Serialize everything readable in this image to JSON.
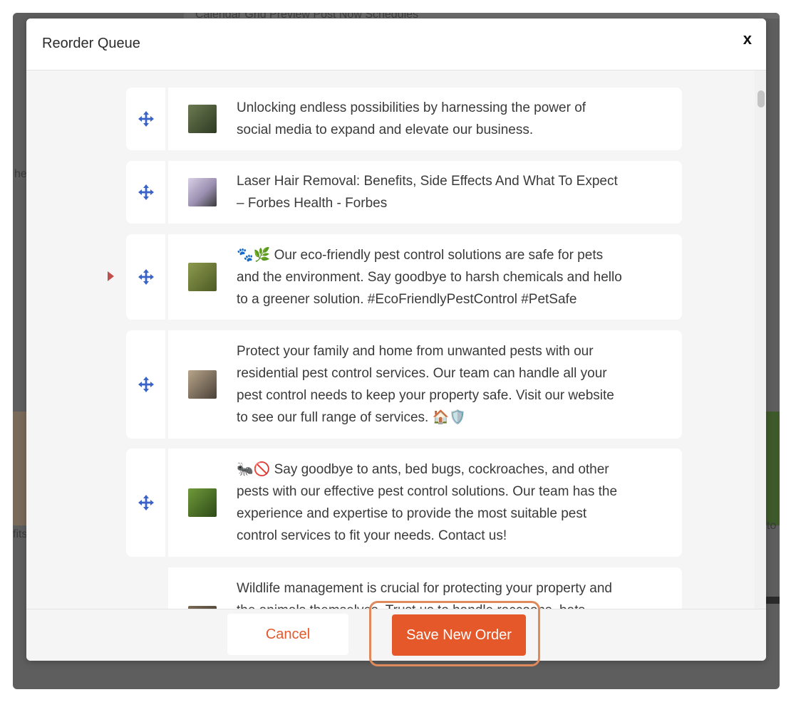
{
  "modal": {
    "title": "Reorder Queue",
    "close_label": "x"
  },
  "background": {
    "tabs": "Calendar   Grid Preview   Post Now   Schedules",
    "left_fragments": [
      "he",
      "fits"
    ],
    "right_fragment": "to"
  },
  "colors": {
    "accent": "#e4582a",
    "move_icon": "#3a63c8",
    "current_marker": "#c0504d",
    "focus_ring": "#e08a5c"
  },
  "queue": {
    "items": [
      {
        "text": "Unlocking endless possibilities by harnessing the power of\nsocial media to expand and elevate our business.",
        "thumb_icon": "person-with-camera-photo",
        "thumb_colors": [
          "#6b7a52",
          "#2f3a22"
        ],
        "current": false
      },
      {
        "text": "Laser Hair Removal: Benefits, Side Effects And What To Expect\n– Forbes Health - Forbes",
        "thumb_icon": "woman-face-photo",
        "thumb_colors": [
          "#d9d0e6",
          "#3a3a3a"
        ],
        "current": false
      },
      {
        "text": "🐾🌿 Our eco-friendly pest control solutions are safe for pets\nand the environment. Say goodbye to harsh chemicals and hello\nto a greener solution. #EcoFriendlyPestControl #PetSafe",
        "thumb_icon": "grass-field-photo",
        "thumb_colors": [
          "#8c9a4e",
          "#4d5a24"
        ],
        "current": true
      },
      {
        "text": "Protect your family and home from unwanted pests with our\nresidential pest control services. Our team can handle all your\npest control needs to keep your property safe. Visit our website\nto see our full range of services. 🏠🛡️",
        "thumb_icon": "technician-spraying-photo",
        "thumb_colors": [
          "#b8a58a",
          "#4a4038"
        ],
        "current": false
      },
      {
        "text": "🐜🚫 Say goodbye to ants, bed bugs, cockroaches, and other\npests with our effective pest control solutions. Our team has the\nexperience and expertise to provide the most suitable pest\ncontrol services to fit your needs. Contact us!",
        "thumb_icon": "insect-on-leaf-photo",
        "thumb_colors": [
          "#6f9a3a",
          "#2e4a18"
        ],
        "current": false
      },
      {
        "text": "Wildlife management is crucial for protecting your property and\nthe animals themselves. Trust us to handle raccoons, bats,",
        "thumb_icon": "wildlife-photo",
        "thumb_colors": [
          "#7a6a55",
          "#3a3228"
        ],
        "current": false
      }
    ]
  },
  "footer": {
    "cancel_label": "Cancel",
    "save_label": "Save New Order"
  }
}
